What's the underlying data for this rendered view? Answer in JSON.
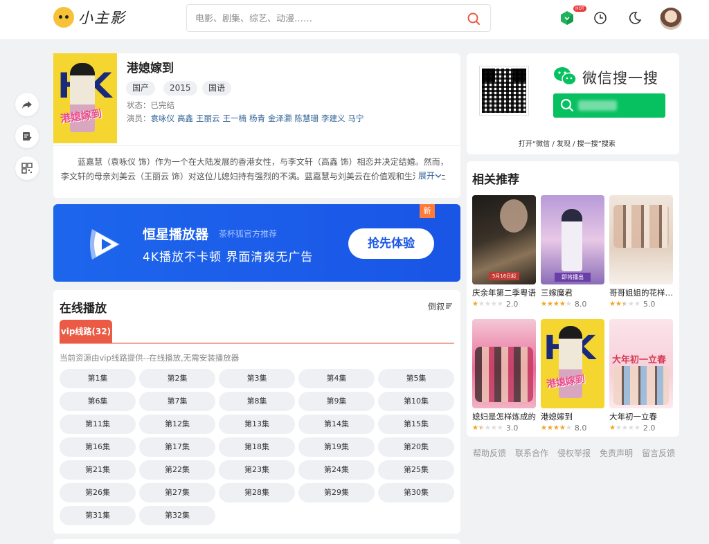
{
  "header": {
    "logo_text": "小主影",
    "search_placeholder": "电影、剧集、综艺、动漫……",
    "hot_badge": "HOT"
  },
  "movie": {
    "title": "港媳嫁到",
    "tags": [
      "国产",
      "2015",
      "国语"
    ],
    "status_label": "状态：已完结",
    "actors_label": "演员：",
    "actors": [
      "袁咏仪",
      "高鑫",
      "王丽云",
      "王一楠",
      "杨青",
      "金泽灏",
      "陈慧珊",
      "李建义",
      "马宁"
    ],
    "description": "蓝嘉慧（袁咏仪 饰）作为一个在大陆发展的香港女性，与李文轩（高鑫 饰）相恋并决定结婚。然而，李文轩的母亲刘美云（王丽云 饰）对这位儿媳妇持有强烈的不满。蓝嘉慧与刘美云在价值观和生活习惯上存在巨大差异……",
    "expand_label": "展开",
    "poster_text": "港媳嫁到"
  },
  "banner": {
    "title": "恒星播放器",
    "subtitle": "茶杯狐官方推荐",
    "slogan": "4K播放不卡顿  界面清爽无广告",
    "button": "抢先体验",
    "new_badge": "新"
  },
  "playlist": {
    "section_title": "在线播放",
    "sort_label": "倒叙",
    "line_tab": "vip线路(32)",
    "hint": "当前资源由vip线路提供--在线播放,无需安装播放器",
    "episodes": [
      "第1集",
      "第2集",
      "第3集",
      "第4集",
      "第5集",
      "第6集",
      "第7集",
      "第8集",
      "第9集",
      "第10集",
      "第11集",
      "第12集",
      "第13集",
      "第14集",
      "第15集",
      "第16集",
      "第17集",
      "第18集",
      "第19集",
      "第20集",
      "第21集",
      "第22集",
      "第23集",
      "第24集",
      "第25集",
      "第26集",
      "第27集",
      "第28集",
      "第29集",
      "第30集",
      "第31集",
      "第32集"
    ]
  },
  "wechat": {
    "title": "微信搜一搜",
    "caption": "打开“微信 / 发现 / 搜一搜”搜索"
  },
  "recommend": {
    "section_title": "相关推荐",
    "items": [
      {
        "name": "庆余年第二季粤语",
        "rating": "2.0",
        "score": 0.2
      },
      {
        "name": "三嫁魔君",
        "rating": "8.0",
        "score": 0.8
      },
      {
        "name": "哥哥姐姐的花样年华",
        "rating": "5.0",
        "score": 0.5
      },
      {
        "name": "媳妇是怎样炼成的",
        "rating": "3.0",
        "score": 0.3
      },
      {
        "name": "港媳嫁到",
        "rating": "8.0",
        "score": 0.8
      },
      {
        "name": "大年初一立春",
        "rating": "2.0",
        "score": 0.2
      }
    ],
    "poster_texts": [
      "5月16日起",
      "即将播出",
      "大年初一立春"
    ]
  },
  "footer": {
    "links": [
      "帮助反馈",
      "联系合作",
      "侵权举报",
      "免责声明",
      "留言反馈"
    ]
  },
  "colors": {
    "accent": "#ea5a44",
    "banner_blue": "#1a55e6",
    "wechat_green": "#07c160",
    "link": "#2e5f94",
    "star": "#f5a623"
  }
}
